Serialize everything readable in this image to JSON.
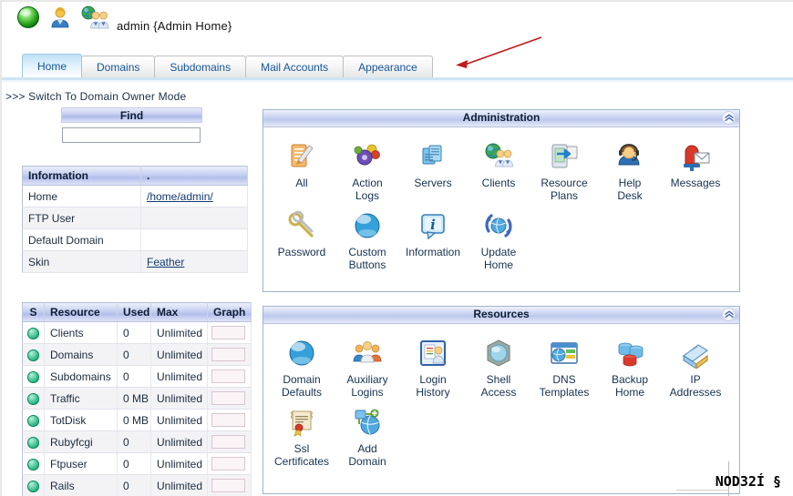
{
  "header": {
    "title": "admin {Admin Home}",
    "icons": [
      "green-orb-icon",
      "user-icon",
      "globe-users-icon"
    ]
  },
  "tabs": [
    {
      "label": "Home",
      "active": true
    },
    {
      "label": "Domains",
      "active": false
    },
    {
      "label": "Subdomains",
      "active": false
    },
    {
      "label": "Mail Accounts",
      "active": false
    },
    {
      "label": "Appearance",
      "active": false
    }
  ],
  "switch_mode_link": ">>> Switch To Domain Owner Mode",
  "find": {
    "title": "Find",
    "value": "",
    "placeholder": ""
  },
  "information": {
    "headers": [
      "Information",
      "."
    ],
    "rows": [
      {
        "label": "Home",
        "value": "/home/admin/",
        "link": true
      },
      {
        "label": "FTP User",
        "value": "",
        "link": false
      },
      {
        "label": "Default Domain",
        "value": "",
        "link": false
      },
      {
        "label": "Skin",
        "value": "Feather",
        "link": true
      }
    ]
  },
  "resources_table": {
    "headers": [
      "S",
      "Resource",
      "Used",
      "Max",
      "Graph"
    ],
    "rows": [
      {
        "status": "green",
        "resource": "Clients",
        "used": "0",
        "max": "Unlimited"
      },
      {
        "status": "green",
        "resource": "Domains",
        "used": "0",
        "max": "Unlimited"
      },
      {
        "status": "green",
        "resource": "Subdomains",
        "used": "0",
        "max": "Unlimited"
      },
      {
        "status": "green",
        "resource": "Traffic",
        "used": "0 MB",
        "max": "Unlimited"
      },
      {
        "status": "green",
        "resource": "TotDisk",
        "used": "0 MB",
        "max": "Unlimited"
      },
      {
        "status": "green",
        "resource": "Rubyfcgi",
        "used": "0",
        "max": "Unlimited"
      },
      {
        "status": "green",
        "resource": "Ftpuser",
        "used": "0",
        "max": "Unlimited"
      },
      {
        "status": "green",
        "resource": "Rails",
        "used": "0",
        "max": "Unlimited"
      }
    ]
  },
  "administration_panel": {
    "title": "Administration",
    "collapse_icon": "chevron-double-up-icon",
    "row1": [
      {
        "label": "All",
        "icon": "clipboard-pen-icon"
      },
      {
        "label": "Action\nLogs",
        "icon": "gears-icon"
      },
      {
        "label": "Servers",
        "icon": "servers-icon"
      },
      {
        "label": "Clients",
        "icon": "globe-clients-icon"
      },
      {
        "label": "Resource\nPlans",
        "icon": "plan-export-icon"
      },
      {
        "label": "Help\nDesk",
        "icon": "headset-support-icon"
      },
      {
        "label": "Messages",
        "icon": "mailbox-envelope-icon"
      }
    ],
    "row2": [
      {
        "label": "Password",
        "icon": "keys-icon"
      },
      {
        "label": "Custom\nButtons",
        "icon": "blue-sphere-icon"
      },
      {
        "label": "Information",
        "icon": "info-bubble-icon"
      },
      {
        "label": "Update\nHome",
        "icon": "refresh-globe-icon"
      }
    ]
  },
  "resources_panel": {
    "title": "Resources",
    "collapse_icon": "chevron-double-up-icon",
    "row1": [
      {
        "label": "Domain\nDefaults",
        "icon": "blue-sphere-icon"
      },
      {
        "label": "Auxiliary\nLogins",
        "icon": "users-group-icon"
      },
      {
        "label": "Login\nHistory",
        "icon": "login-history-icon"
      },
      {
        "label": "Shell\nAccess",
        "icon": "shell-access-icon"
      },
      {
        "label": "DNS\nTemplates",
        "icon": "dns-window-icon"
      },
      {
        "label": "Backup\nHome",
        "icon": "database-backup-icon"
      },
      {
        "label": "IP\nAddresses",
        "icon": "ip-address-icon"
      }
    ],
    "row2": [
      {
        "label": "Ssl\nCertificates",
        "icon": "certificate-scroll-icon"
      },
      {
        "label": "Add\nDomain",
        "icon": "add-domain-icon"
      }
    ]
  },
  "watermark": "NOD32Í §",
  "colors": {
    "tab_active_text": "#15559a",
    "panel_header_start": "#eff2fc",
    "panel_header_end": "#bcc8ec",
    "link": "#10386e",
    "status_green": "#1faa77",
    "annotation_arrow": "#c0191b"
  }
}
